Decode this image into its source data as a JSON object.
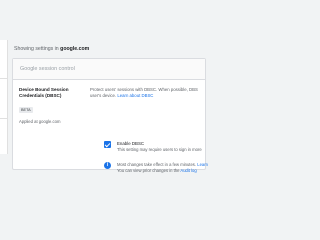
{
  "header": {
    "showing_prefix": "Showing settings in",
    "org_domain": "google.com"
  },
  "section": {
    "title": "Google session control"
  },
  "setting": {
    "name_line1": "Device Bound Session",
    "name_line2": "Credentials (DBSC)",
    "badge": "BETA",
    "applied": "Applied at google.com",
    "description_line1": "Protect users' sessions with DBSC. When possible, DBS",
    "description_line2_prefix": "user's device.",
    "learn_more": "Learn about DBSC",
    "checkbox": {
      "checked": true,
      "label": "Enable DBSC",
      "sublabel": "This setting may require users to sign in more"
    },
    "info": {
      "icon": "info-icon",
      "line1_prefix": "Most changes take effect in a few minutes.",
      "line1_link": "Learn",
      "line2_prefix": "You can view prior changes in the",
      "line2_link": "Audit log"
    }
  },
  "colors": {
    "accent": "#1a73e8",
    "background": "#f1f3f4"
  }
}
